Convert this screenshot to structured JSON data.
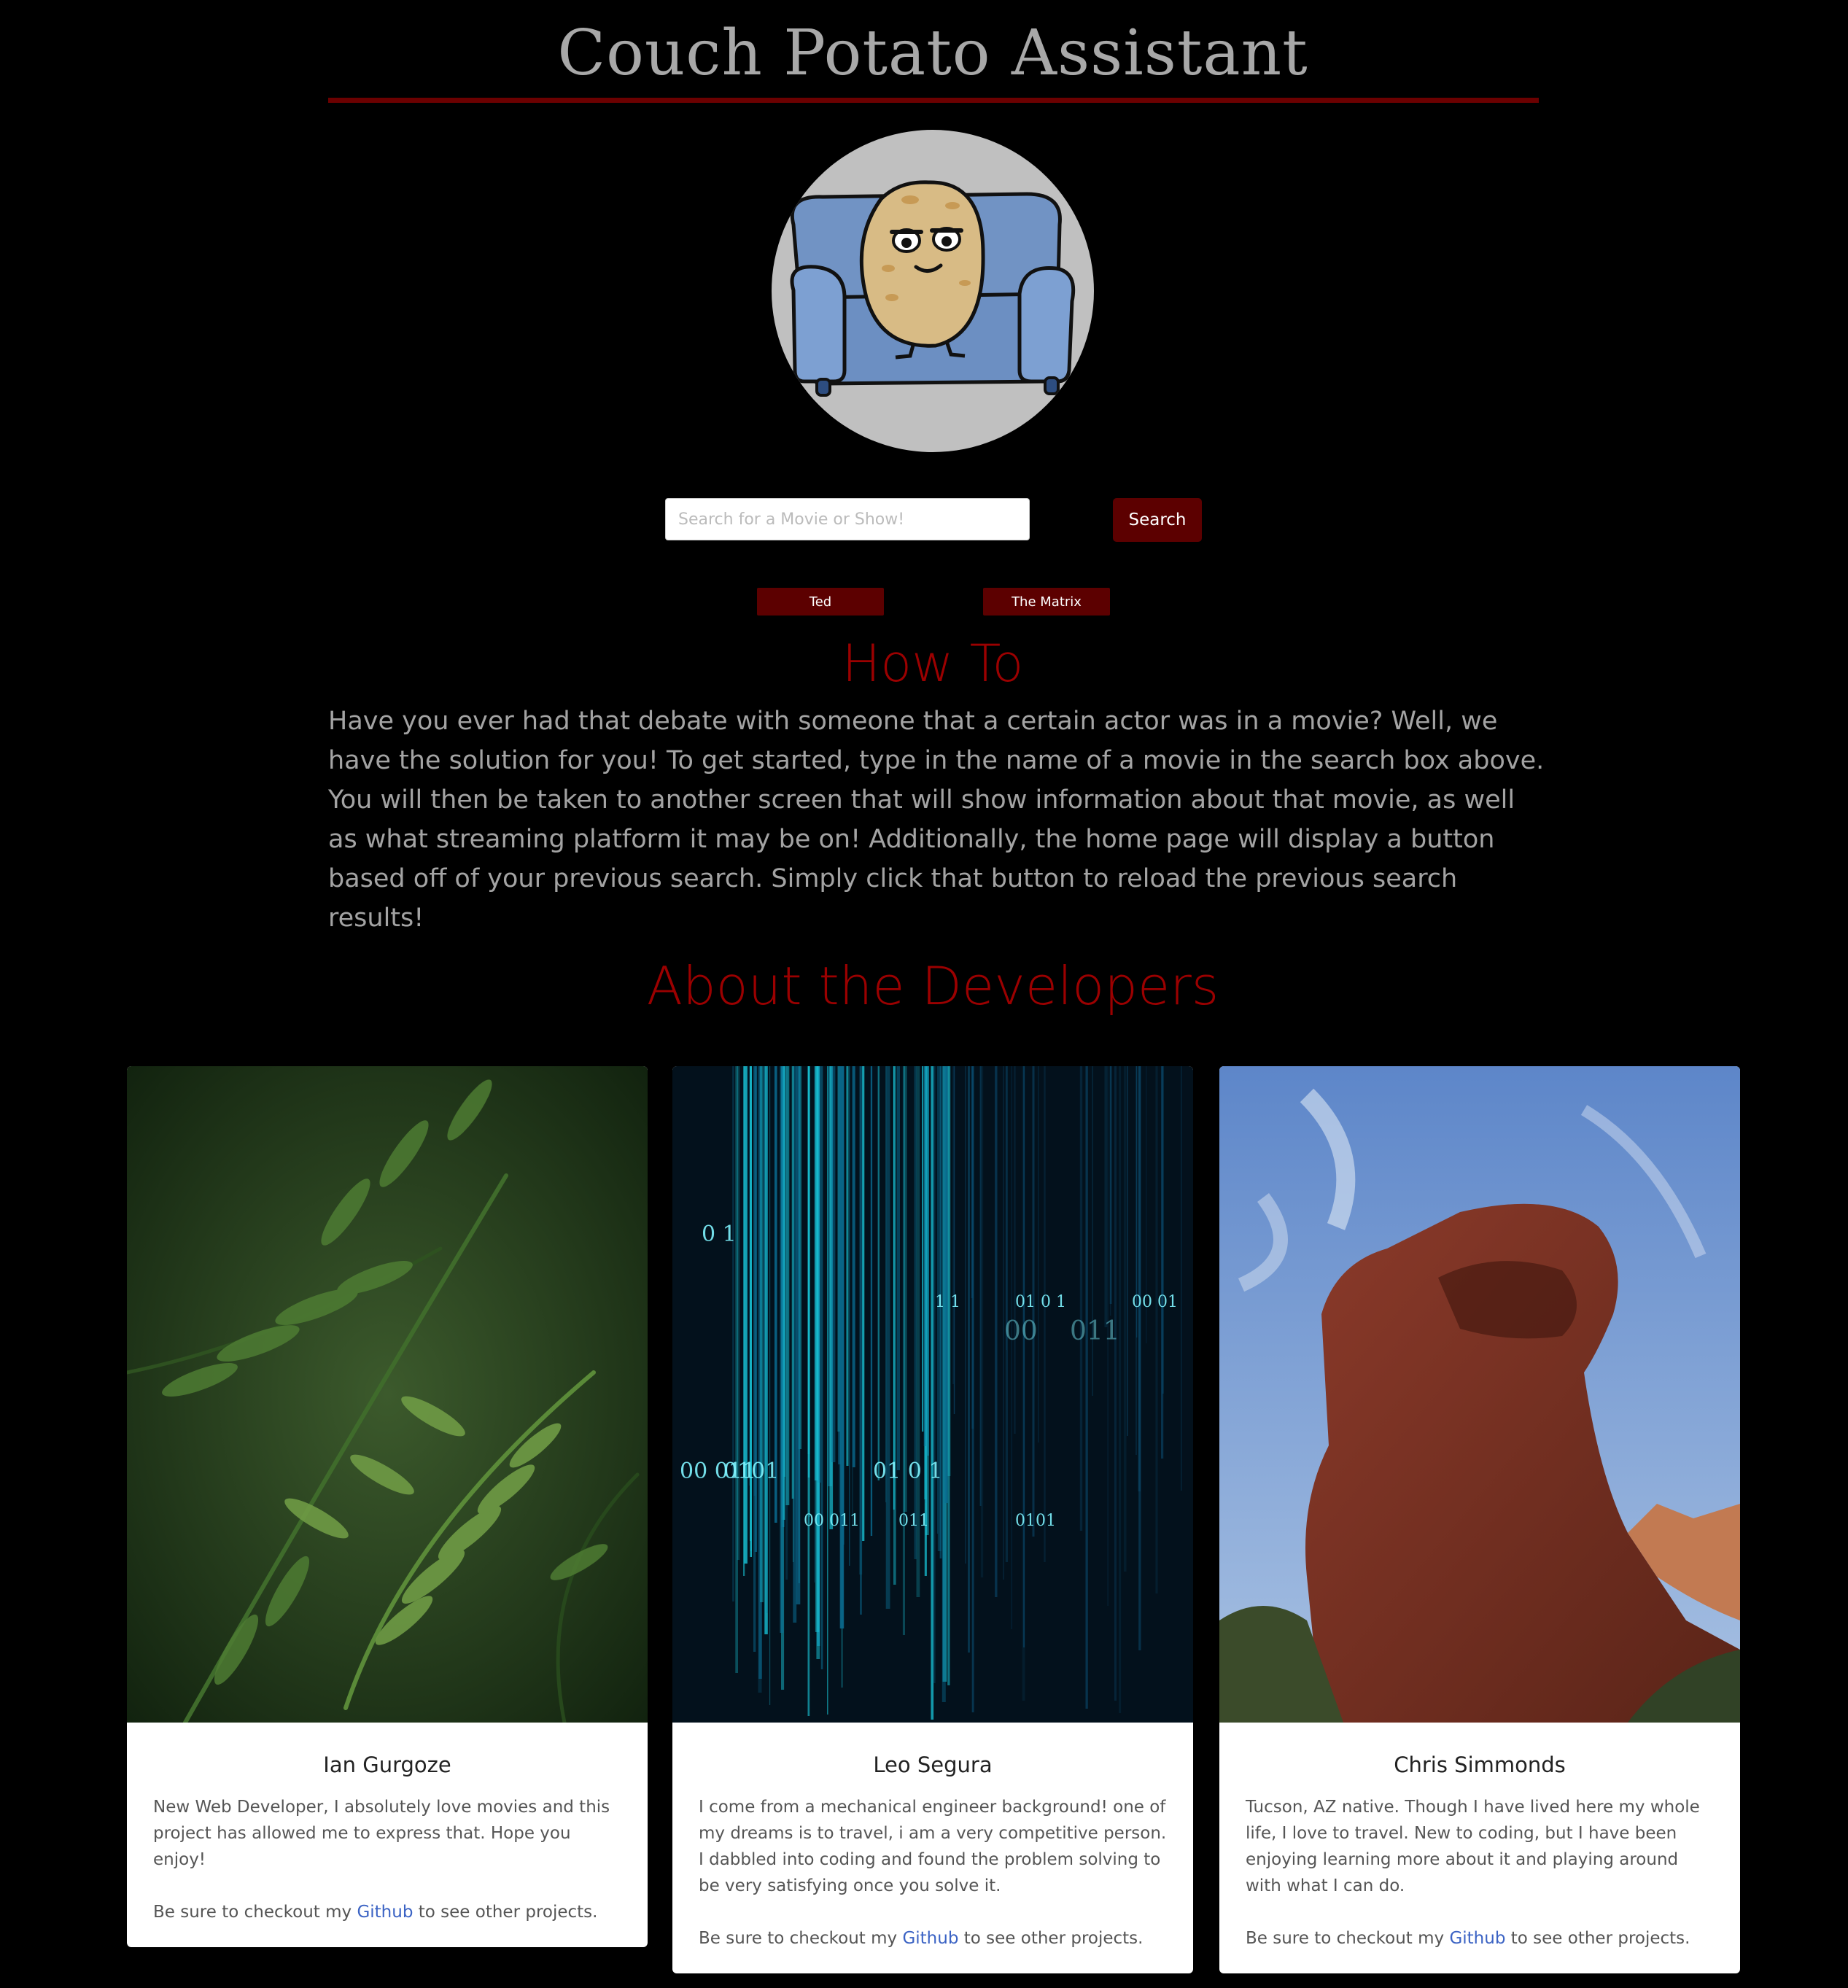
{
  "header": {
    "title": "Couch Potato Assistant"
  },
  "search": {
    "placeholder": "Search for a Movie or Show!",
    "button_label": "Search"
  },
  "recent_searches": [
    "Ted",
    "The Matrix"
  ],
  "howto": {
    "title": "How To",
    "text": "Have you ever had that debate with someone that a certain actor was in a movie? Well, we have the solution for you! To get started, type in the name of a movie in the search box above. You will then be taken to another screen that will show information about that movie, as well as what streaming platform it may be on! Additionally, the home page will display a button based off of your previous search. Simply click that button to reload the previous search results!"
  },
  "about": {
    "title": "About the Developers"
  },
  "developers": [
    {
      "name": "Ian Gurgoze",
      "description": "New Web Developer, I absolutely love movies and this project has allowed me to express that. Hope you enjoy!",
      "github_prefix": "Be sure to checkout my",
      "github_link": "Github",
      "github_suffix": "to see other projects."
    },
    {
      "name": "Leo Segura",
      "description": "I come from a mechanical engineer background! one of my dreams is to travel, i am a very competitive person. I dabbled into coding and found the problem solving to be very satisfying once you solve it.",
      "github_prefix": "Be sure to checkout my",
      "github_link": "Github",
      "github_suffix": "to see other projects."
    },
    {
      "name": "Chris Simmonds",
      "description": "Tucson, AZ native. Though I have lived here my whole life, I love to travel. New to coding, but I have been enjoying learning more about it and playing around with what I can do.",
      "github_prefix": "Be sure to checkout my",
      "github_link": "Github",
      "github_suffix": "to see other projects."
    }
  ],
  "colors": {
    "accent": "#5c0000",
    "heading": "#9b0000",
    "link": "#3b63c4",
    "background": "#000000"
  },
  "matrix_glyphs": [
    "0 1",
    "1 1",
    "01 0 1",
    "00 01",
    "00",
    "011",
    "00 011",
    "0101",
    "01 0 1",
    "00 011",
    "011",
    "0101"
  ]
}
